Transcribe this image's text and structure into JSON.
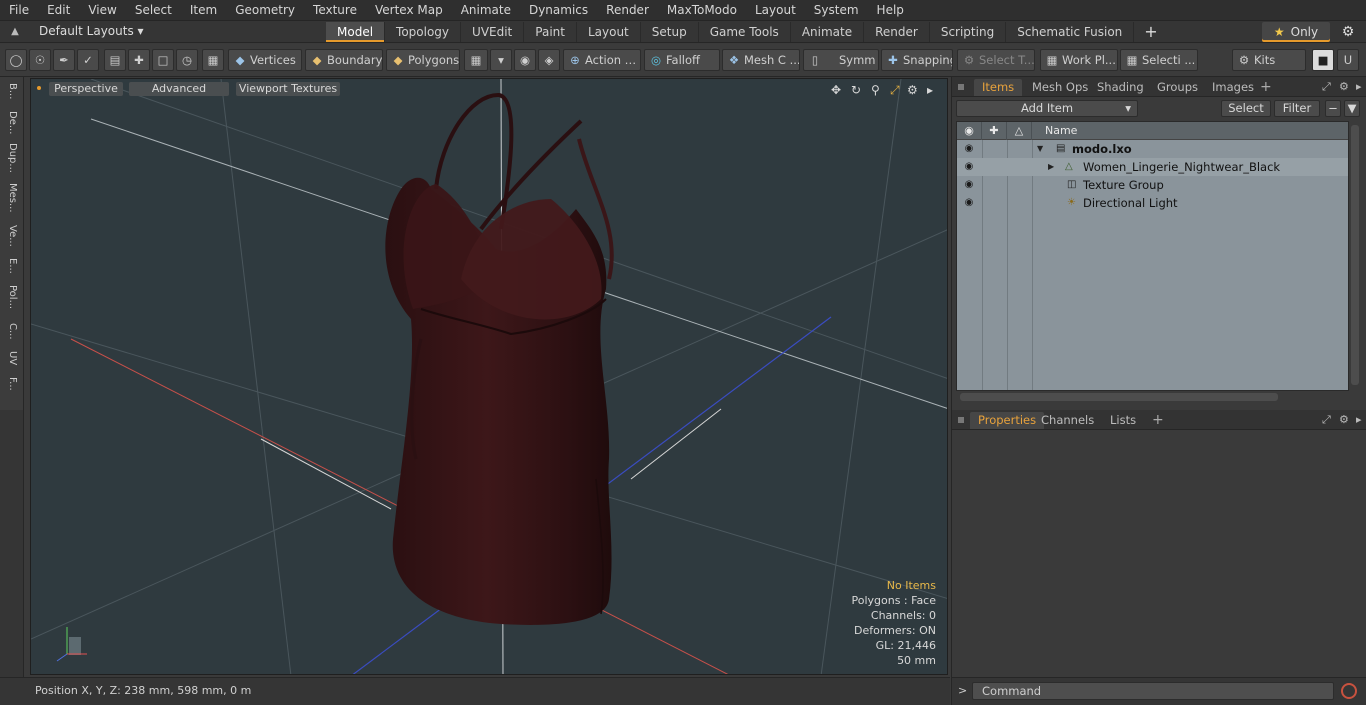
{
  "menu": [
    "File",
    "Edit",
    "View",
    "Select",
    "Item",
    "Geometry",
    "Texture",
    "Vertex Map",
    "Animate",
    "Dynamics",
    "Render",
    "MaxToModo",
    "Layout",
    "System",
    "Help"
  ],
  "layouts_label": "Default Layouts ▾",
  "tabs": [
    "Model",
    "Topology",
    "UVEdit",
    "Paint",
    "Layout",
    "Setup",
    "Game Tools",
    "Animate",
    "Render",
    "Scripting",
    "Schematic Fusion"
  ],
  "tabs_plus": "+",
  "only_label": "Only",
  "toolbar": {
    "vertices": "Vertices",
    "boundary": "Boundary",
    "polygons": "Polygons",
    "action": "Action",
    "falloff": "Falloff",
    "mesh_c": "Mesh C ...",
    "symm": "Symm ...",
    "snapping": "Snapping",
    "select_t": "Select T...",
    "work_pl": "Work Pl...",
    "selecti": "Selecti ...",
    "kits": "Kits"
  },
  "left_strip": [
    "B...",
    "De...",
    "Dup...",
    "Mes...",
    "Ve...",
    "E...",
    "Pol...",
    "C...",
    "UV",
    "F..."
  ],
  "viewport": {
    "perspective": "Perspective",
    "advanced": "Advanced",
    "viewport_textures": "Viewport Textures",
    "info": {
      "no_items": "No Items",
      "polygons": "Polygons : Face",
      "channels": "Channels: 0",
      "deformers": "Deformers: ON",
      "gl": "GL: 21,446",
      "scale": "50 mm"
    }
  },
  "status": {
    "position": "Position X, Y, Z:  238 mm, 598 mm, 0 m"
  },
  "items_panel": {
    "tabs": [
      "Items",
      "Mesh Ops",
      "Shading",
      "Groups",
      "Images"
    ],
    "add_item": "Add Item",
    "select": "Select",
    "filter": "Filter",
    "column_name": "Name",
    "rows": [
      {
        "label": "modo.lxo"
      },
      {
        "label": "Women_Lingerie_Nightwear_Black"
      },
      {
        "label": "Texture Group"
      },
      {
        "label": "Directional Light"
      }
    ]
  },
  "properties_panel": {
    "tabs": [
      "Properties",
      "Channels",
      "Lists"
    ]
  },
  "command": {
    "prompt": ">",
    "placeholder": "Command"
  },
  "colors": {
    "accent": "#e59a2c",
    "viewport_bg": "#2f3a3f",
    "garment": "#3a1517"
  }
}
